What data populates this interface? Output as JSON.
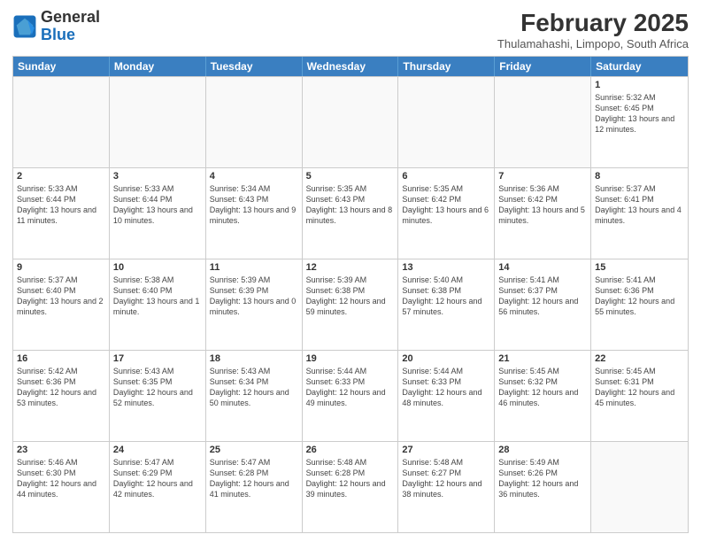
{
  "header": {
    "logo_line1": "General",
    "logo_line2": "Blue",
    "month_title": "February 2025",
    "subtitle": "Thulamahashi, Limpopo, South Africa"
  },
  "weekdays": [
    "Sunday",
    "Monday",
    "Tuesday",
    "Wednesday",
    "Thursday",
    "Friday",
    "Saturday"
  ],
  "rows": [
    [
      {
        "day": "",
        "info": ""
      },
      {
        "day": "",
        "info": ""
      },
      {
        "day": "",
        "info": ""
      },
      {
        "day": "",
        "info": ""
      },
      {
        "day": "",
        "info": ""
      },
      {
        "day": "",
        "info": ""
      },
      {
        "day": "1",
        "info": "Sunrise: 5:32 AM\nSunset: 6:45 PM\nDaylight: 13 hours and 12 minutes."
      }
    ],
    [
      {
        "day": "2",
        "info": "Sunrise: 5:33 AM\nSunset: 6:44 PM\nDaylight: 13 hours and 11 minutes."
      },
      {
        "day": "3",
        "info": "Sunrise: 5:33 AM\nSunset: 6:44 PM\nDaylight: 13 hours and 10 minutes."
      },
      {
        "day": "4",
        "info": "Sunrise: 5:34 AM\nSunset: 6:43 PM\nDaylight: 13 hours and 9 minutes."
      },
      {
        "day": "5",
        "info": "Sunrise: 5:35 AM\nSunset: 6:43 PM\nDaylight: 13 hours and 8 minutes."
      },
      {
        "day": "6",
        "info": "Sunrise: 5:35 AM\nSunset: 6:42 PM\nDaylight: 13 hours and 6 minutes."
      },
      {
        "day": "7",
        "info": "Sunrise: 5:36 AM\nSunset: 6:42 PM\nDaylight: 13 hours and 5 minutes."
      },
      {
        "day": "8",
        "info": "Sunrise: 5:37 AM\nSunset: 6:41 PM\nDaylight: 13 hours and 4 minutes."
      }
    ],
    [
      {
        "day": "9",
        "info": "Sunrise: 5:37 AM\nSunset: 6:40 PM\nDaylight: 13 hours and 2 minutes."
      },
      {
        "day": "10",
        "info": "Sunrise: 5:38 AM\nSunset: 6:40 PM\nDaylight: 13 hours and 1 minute."
      },
      {
        "day": "11",
        "info": "Sunrise: 5:39 AM\nSunset: 6:39 PM\nDaylight: 13 hours and 0 minutes."
      },
      {
        "day": "12",
        "info": "Sunrise: 5:39 AM\nSunset: 6:38 PM\nDaylight: 12 hours and 59 minutes."
      },
      {
        "day": "13",
        "info": "Sunrise: 5:40 AM\nSunset: 6:38 PM\nDaylight: 12 hours and 57 minutes."
      },
      {
        "day": "14",
        "info": "Sunrise: 5:41 AM\nSunset: 6:37 PM\nDaylight: 12 hours and 56 minutes."
      },
      {
        "day": "15",
        "info": "Sunrise: 5:41 AM\nSunset: 6:36 PM\nDaylight: 12 hours and 55 minutes."
      }
    ],
    [
      {
        "day": "16",
        "info": "Sunrise: 5:42 AM\nSunset: 6:36 PM\nDaylight: 12 hours and 53 minutes."
      },
      {
        "day": "17",
        "info": "Sunrise: 5:43 AM\nSunset: 6:35 PM\nDaylight: 12 hours and 52 minutes."
      },
      {
        "day": "18",
        "info": "Sunrise: 5:43 AM\nSunset: 6:34 PM\nDaylight: 12 hours and 50 minutes."
      },
      {
        "day": "19",
        "info": "Sunrise: 5:44 AM\nSunset: 6:33 PM\nDaylight: 12 hours and 49 minutes."
      },
      {
        "day": "20",
        "info": "Sunrise: 5:44 AM\nSunset: 6:33 PM\nDaylight: 12 hours and 48 minutes."
      },
      {
        "day": "21",
        "info": "Sunrise: 5:45 AM\nSunset: 6:32 PM\nDaylight: 12 hours and 46 minutes."
      },
      {
        "day": "22",
        "info": "Sunrise: 5:45 AM\nSunset: 6:31 PM\nDaylight: 12 hours and 45 minutes."
      }
    ],
    [
      {
        "day": "23",
        "info": "Sunrise: 5:46 AM\nSunset: 6:30 PM\nDaylight: 12 hours and 44 minutes."
      },
      {
        "day": "24",
        "info": "Sunrise: 5:47 AM\nSunset: 6:29 PM\nDaylight: 12 hours and 42 minutes."
      },
      {
        "day": "25",
        "info": "Sunrise: 5:47 AM\nSunset: 6:28 PM\nDaylight: 12 hours and 41 minutes."
      },
      {
        "day": "26",
        "info": "Sunrise: 5:48 AM\nSunset: 6:28 PM\nDaylight: 12 hours and 39 minutes."
      },
      {
        "day": "27",
        "info": "Sunrise: 5:48 AM\nSunset: 6:27 PM\nDaylight: 12 hours and 38 minutes."
      },
      {
        "day": "28",
        "info": "Sunrise: 5:49 AM\nSunset: 6:26 PM\nDaylight: 12 hours and 36 minutes."
      },
      {
        "day": "",
        "info": ""
      }
    ]
  ]
}
